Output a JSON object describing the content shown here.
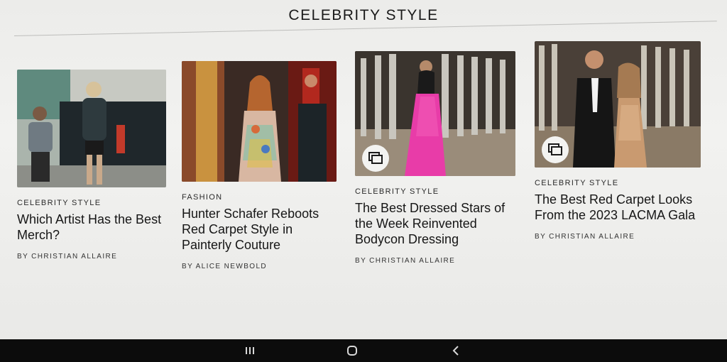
{
  "section": {
    "title": "CELEBRITY STYLE"
  },
  "cards": [
    {
      "kicker": "CELEBRITY STYLE",
      "headline": "Which Artist Has the Best Merch?",
      "byline": "BY CHRISTIAN ALLAIRE",
      "gallery": false,
      "image_colors": [
        "#6b7a72",
        "#2f3a3e",
        "#a8b2aa"
      ]
    },
    {
      "kicker": "FASHION",
      "headline": "Hunter Schafer Reboots Red Carpet Style in Painterly Couture",
      "byline": "BY ALICE NEWBOLD",
      "gallery": false,
      "image_colors": [
        "#7a3a22",
        "#c9923f",
        "#3a2a24"
      ]
    },
    {
      "kicker": "CELEBRITY STYLE",
      "headline": "The Best Dressed Stars of the Week Reinvented Bodycon Dressing",
      "byline": "BY CHRISTIAN ALLAIRE",
      "gallery": true,
      "image_colors": [
        "#8a7e6e",
        "#e83ca8",
        "#c8c4bc"
      ]
    },
    {
      "kicker": "CELEBRITY STYLE",
      "headline": "The Best Red Carpet Looks From the 2023 LACMA Gala",
      "byline": "BY CHRISTIAN ALLAIRE",
      "gallery": true,
      "image_colors": [
        "#5a5048",
        "#1a1a1a",
        "#c99a70"
      ]
    }
  ],
  "system_nav": {
    "recents_icon": "recents-icon",
    "home_icon": "home-icon",
    "back_icon": "back-icon"
  }
}
